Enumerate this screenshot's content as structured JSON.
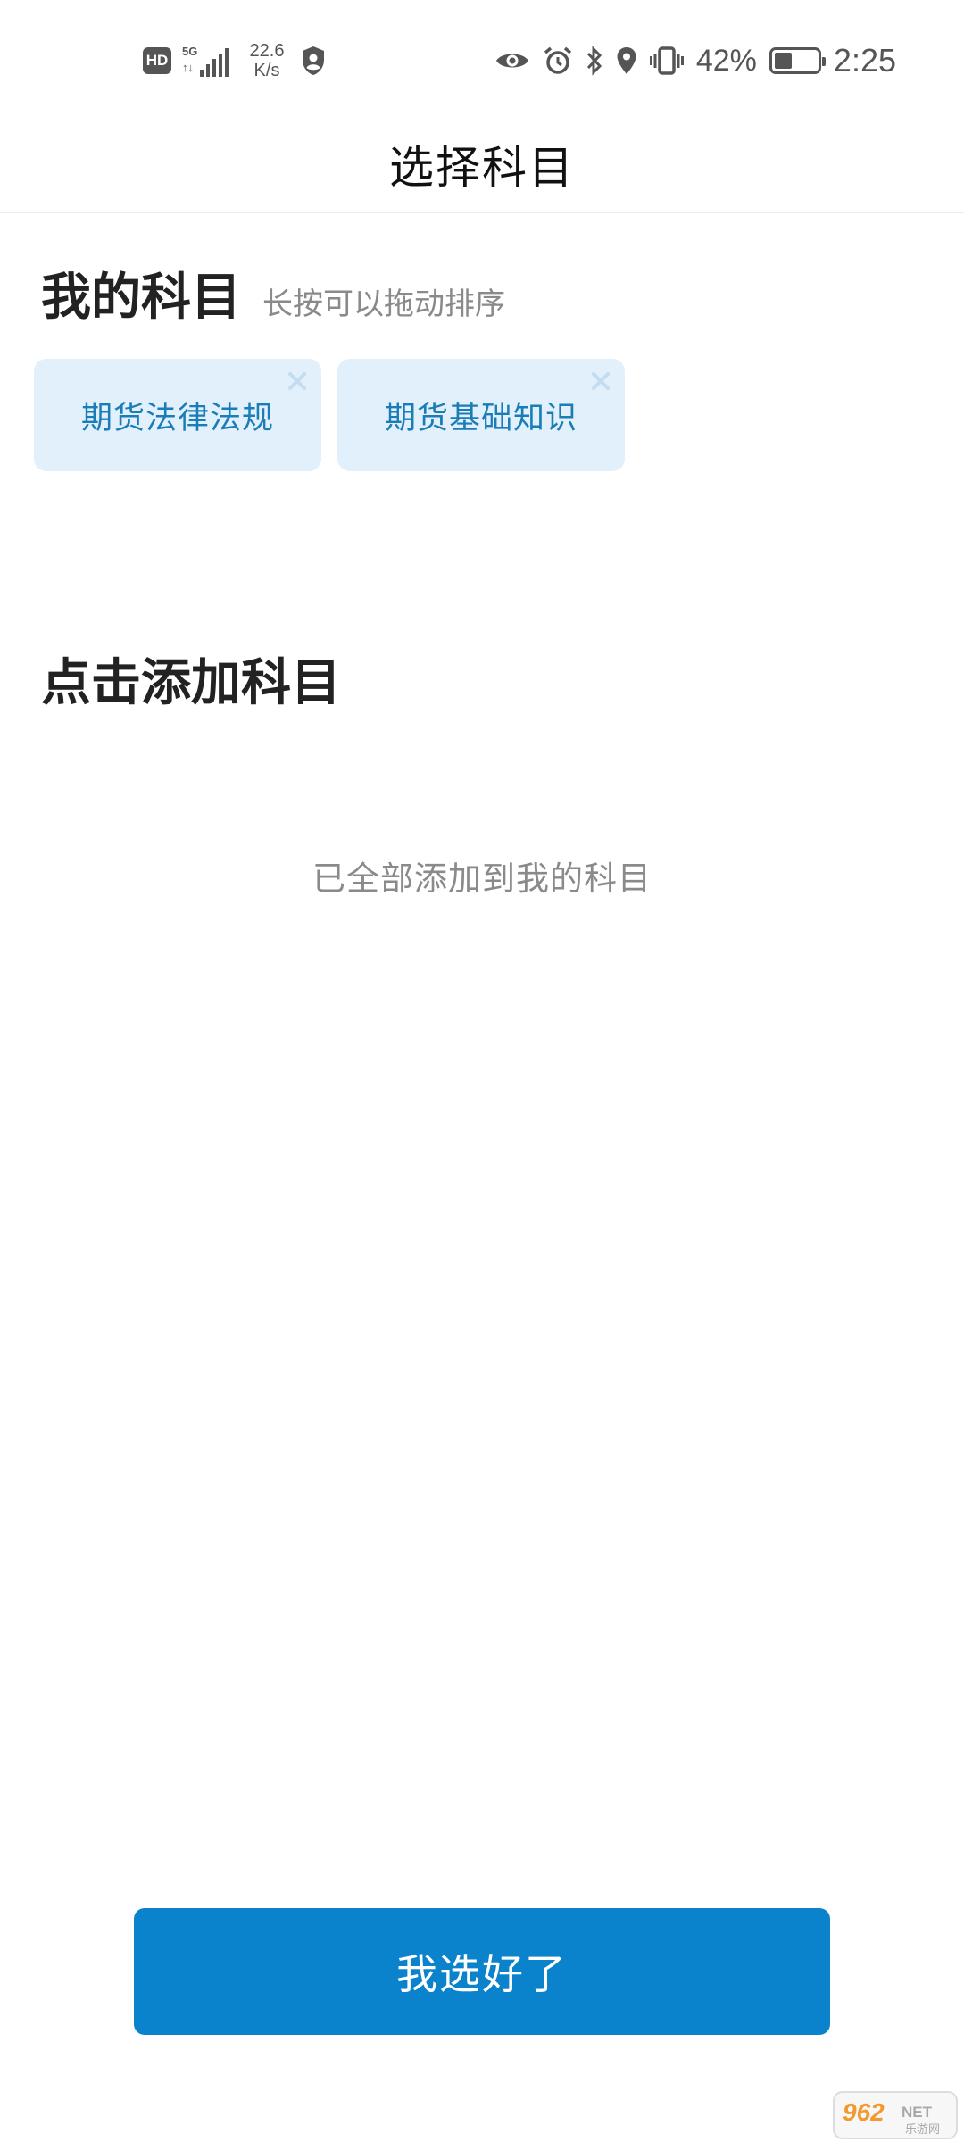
{
  "status_bar": {
    "hd_badge": "HD",
    "network_type": "5G",
    "network_arrows": "↑↓",
    "speed_value": "22.6",
    "speed_unit": "K/s",
    "battery_percent": "42%",
    "battery_level": 0.42,
    "time": "2:25",
    "icons": [
      "shield-icon",
      "eye-icon",
      "alarm-icon",
      "bluetooth-icon",
      "location-icon",
      "vibrate-icon",
      "battery-icon"
    ]
  },
  "header": {
    "title": "选择科目"
  },
  "my_subjects": {
    "title": "我的科目",
    "hint": "长按可以拖动排序",
    "items": [
      {
        "label": "期货法律法规"
      },
      {
        "label": "期货基础知识"
      }
    ]
  },
  "add_subjects": {
    "title": "点击添加科目",
    "empty_message": "已全部添加到我的科目"
  },
  "confirm_button": {
    "label": "我选好了"
  },
  "watermark": {
    "brand": "962",
    "suffix": "NET",
    "subtitle": "乐游网"
  },
  "colors": {
    "accent": "#0a82cc",
    "chip_background": "#e1f0fa",
    "chip_text": "#1a7db8",
    "hint_text": "#8a8a8a"
  }
}
